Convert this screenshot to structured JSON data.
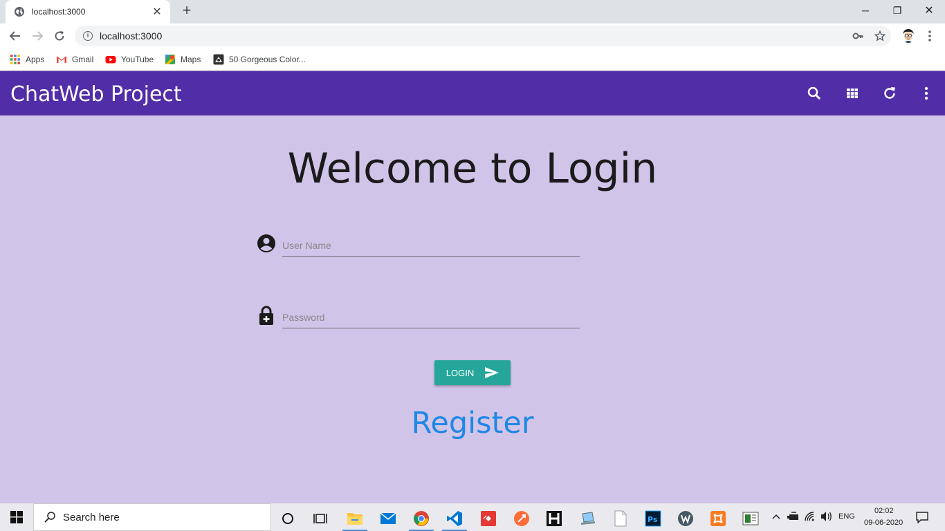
{
  "browser": {
    "tab_title": "localhost:3000",
    "tab_close": "✕",
    "new_tab": "+",
    "url": "localhost:3000",
    "window_controls": {
      "minimize": "─",
      "restore": "❐",
      "close": "✕"
    },
    "bookmarks": [
      {
        "label": "Apps",
        "icon": "apps-grid-icon"
      },
      {
        "label": "Gmail",
        "icon": "gmail-icon"
      },
      {
        "label": "YouTube",
        "icon": "youtube-icon"
      },
      {
        "label": "Maps",
        "icon": "maps-icon"
      },
      {
        "label": "50 Gorgeous Color...",
        "icon": "site-icon"
      }
    ]
  },
  "app": {
    "title": "ChatWeb Project",
    "bar_color": "#512da8",
    "background_color": "#d1c4e9",
    "actions": [
      "search-icon",
      "apps-grid-icon",
      "refresh-icon",
      "more-vert-icon"
    ]
  },
  "login": {
    "heading": "Welcome to Login",
    "username": {
      "placeholder": "User Name",
      "value": ""
    },
    "password": {
      "placeholder": "Password",
      "value": ""
    },
    "button_label": "LOGIN",
    "button_color": "#26a69a",
    "register_link": "Register",
    "register_color": "#1e88e5"
  },
  "taskbar": {
    "search_placeholder": "Search here",
    "language": "ENG",
    "time": "02:02",
    "date": "09-06-2020"
  }
}
